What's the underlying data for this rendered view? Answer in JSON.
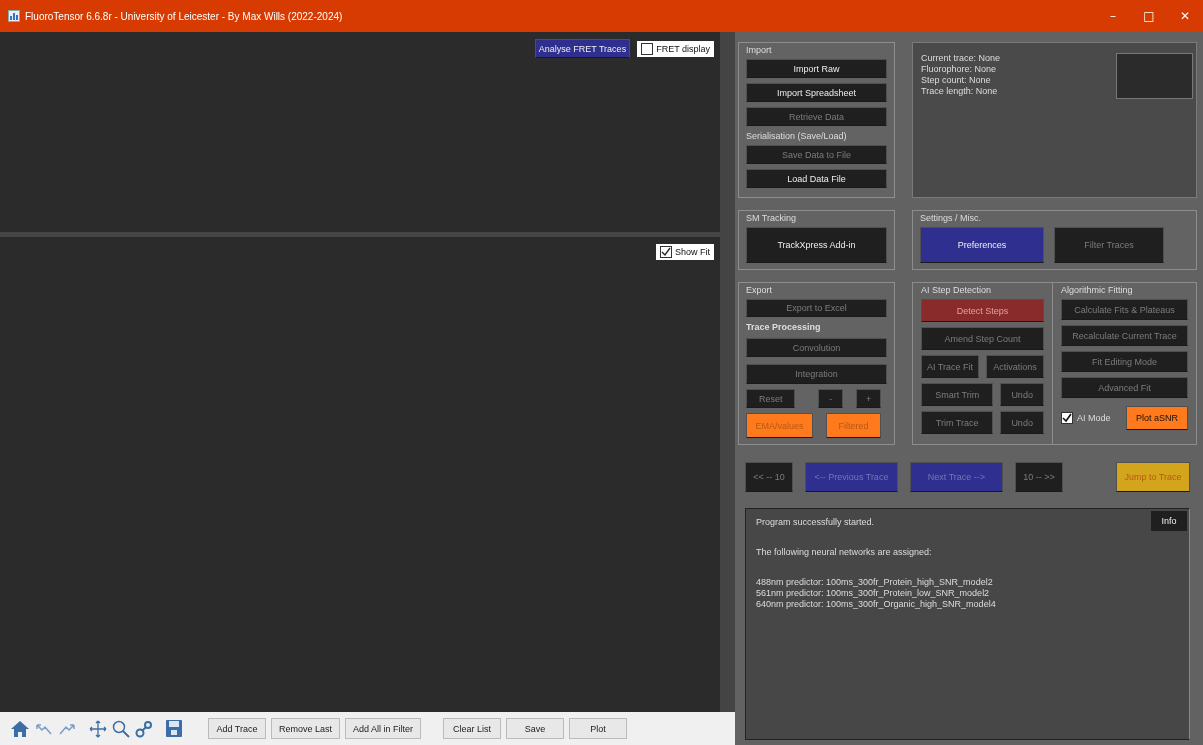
{
  "window": {
    "title": "FluoroTensor 6.6.8r - University of Leicester - By Max Wills (2022-2024)",
    "controls": [
      "–",
      "□",
      "✕"
    ]
  },
  "top_plot": {
    "analyse_button": {
      "label": "Analyse FRET Traces",
      "kind": "primary",
      "disabled": false
    },
    "fret_display": {
      "label": "FRET display",
      "checked": false
    }
  },
  "bottom_plot": {
    "show_fit": {
      "label": "Show Fit",
      "checked": true
    }
  },
  "toolbar": {
    "button_groups": [
      [
        "Add Trace",
        "Remove Last",
        "Add All in Filter"
      ],
      [
        "Clear List",
        "Save",
        "Plot"
      ]
    ]
  },
  "import_group": {
    "title": "Import",
    "buttons": [
      {
        "label": "Import Raw",
        "kind": "normal",
        "disabled": false
      },
      {
        "label": "Import Spreadsheet",
        "kind": "normal",
        "disabled": false
      },
      {
        "label": "Retrieve Data",
        "kind": "normal",
        "disabled": true
      }
    ],
    "subtitle": "Serialisation (Save/Load)",
    "serial_buttons": [
      {
        "label": "Save Data to File",
        "kind": "normal",
        "disabled": true
      },
      {
        "label": "Load Data File",
        "kind": "normal",
        "disabled": false
      }
    ]
  },
  "trace_info": {
    "lines": [
      "Current trace: None",
      "Fluorophore: None",
      "Step count: None",
      "Trace length: None"
    ]
  },
  "sm_tracking": {
    "title": "SM Tracking",
    "button": {
      "label": "TrackXpress Add-in",
      "kind": "normal",
      "disabled": false
    }
  },
  "settings": {
    "title": "Settings / Misc.",
    "buttons": [
      {
        "label": "Preferences",
        "kind": "primary",
        "disabled": false
      },
      {
        "label": "Filter Traces",
        "kind": "normal",
        "disabled": true
      }
    ]
  },
  "export_group": {
    "title": "Export",
    "export_button": {
      "label": "Export to Excel",
      "kind": "normal",
      "disabled": true
    },
    "subtitle": "Trace Processing",
    "buttons": [
      {
        "label": "Convolution",
        "kind": "normal",
        "disabled": true
      },
      {
        "label": "Integration",
        "kind": "normal",
        "disabled": true
      }
    ],
    "small_buttons": [
      {
        "label": "Reset",
        "kind": "normal",
        "disabled": true
      },
      {
        "label": "-",
        "kind": "normal",
        "disabled": true
      },
      {
        "label": "+",
        "kind": "normal",
        "disabled": true
      }
    ],
    "orange_buttons": [
      {
        "label": "EMA/values",
        "kind": "accent",
        "disabled": true
      },
      {
        "label": "Filtered",
        "kind": "accent",
        "disabled": true
      }
    ]
  },
  "ai_step_detection": {
    "title": "AI Step Detection",
    "rows": [
      [
        {
          "label": "Detect Steps",
          "kind": "danger",
          "disabled": true
        }
      ],
      [
        {
          "label": "Amend Step Count",
          "kind": "normal",
          "disabled": true
        }
      ],
      [
        {
          "label": "AI Trace Fit",
          "kind": "normal",
          "disabled": true
        },
        {
          "label": "Activations",
          "kind": "normal",
          "disabled": true
        }
      ],
      [
        {
          "label": "Smart Trim",
          "kind": "normal",
          "disabled": true
        },
        {
          "label": "Undo",
          "kind": "normal",
          "disabled": true
        }
      ],
      [
        {
          "label": "Trim Trace",
          "kind": "normal",
          "disabled": true
        },
        {
          "label": "Undo",
          "kind": "normal",
          "disabled": true
        }
      ]
    ]
  },
  "algorithmic_fitting": {
    "title": "Algorithmic Fitting",
    "buttons": [
      {
        "label": "Calculate Fits & Plateaus",
        "kind": "normal",
        "disabled": true
      },
      {
        "label": "Recalculate Current Trace",
        "kind": "normal",
        "disabled": true
      },
      {
        "label": "Fit Editing Mode",
        "kind": "normal",
        "disabled": true
      },
      {
        "label": "Advanced Fit",
        "kind": "normal",
        "disabled": true
      }
    ],
    "ai_mode": {
      "label": "AI Mode",
      "checked": true
    },
    "plot_button": {
      "label": "Plot aSNR",
      "kind": "accent",
      "disabled": false
    }
  },
  "navigation": [
    {
      "label": "<< -- 10",
      "kind": "normal",
      "disabled": true
    },
    {
      "label": "<-- Previous Trace",
      "kind": "primary",
      "disabled": true
    },
    {
      "label": "Next Trace -->",
      "kind": "primary",
      "disabled": true
    },
    {
      "label": "10 -- >>",
      "kind": "normal",
      "disabled": true
    },
    {
      "label": "Jump to Trace",
      "kind": "warning",
      "disabled": true
    }
  ],
  "log": {
    "info_button": "Info",
    "paragraphs": [
      [
        "Program successfully started."
      ],
      [
        "The following neural networks are assigned:"
      ],
      [
        "488nm predictor: 100ms_300fr_Protein_high_SNR_model2",
        "561nm predictor: 100ms_300fr_Protein_low_SNR_model2",
        "640nm predictor: 100ms_300fr_Organic_high_SNR_model4"
      ]
    ]
  }
}
